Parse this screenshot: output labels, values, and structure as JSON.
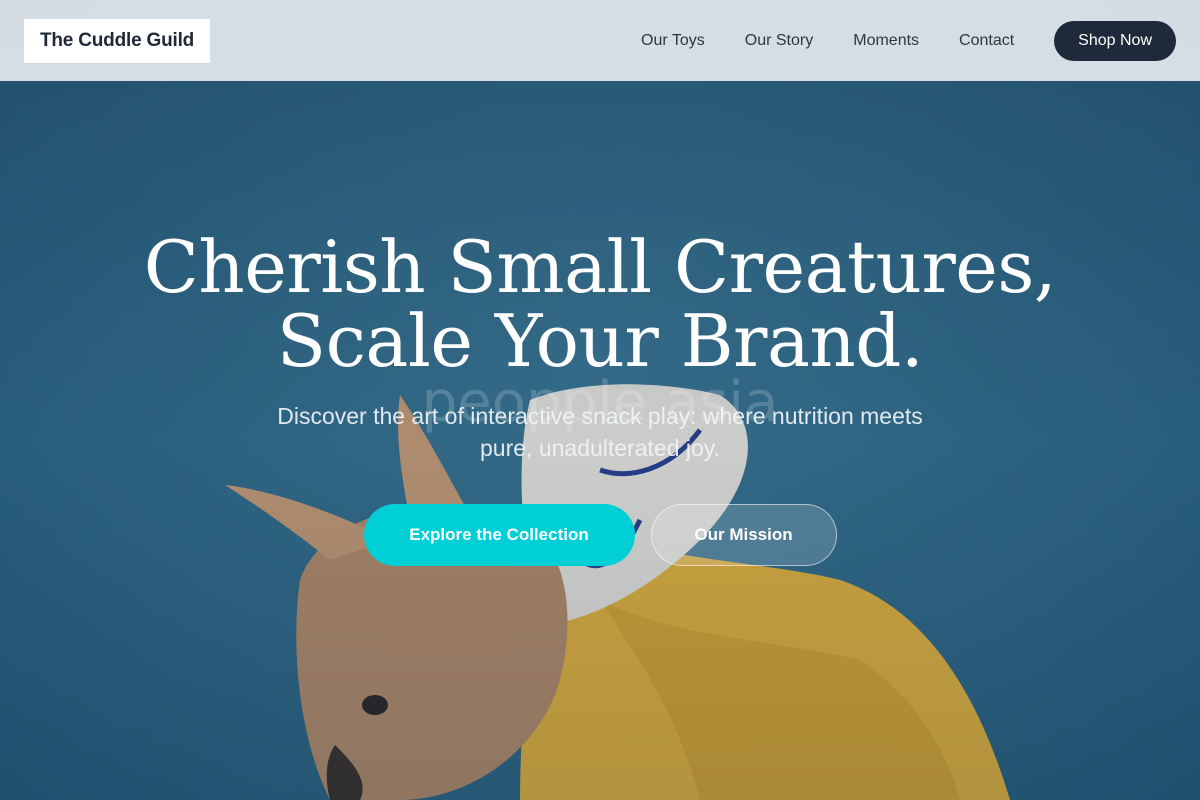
{
  "brand": {
    "name": "The Cuddle Guild"
  },
  "nav": {
    "items": [
      {
        "label": "Our Toys"
      },
      {
        "label": "Our Story"
      },
      {
        "label": "Moments"
      },
      {
        "label": "Contact"
      }
    ],
    "cta_label": "Shop Now"
  },
  "hero": {
    "headline_line1": "Cherish Small Creatures,",
    "headline_line2": "Scale Your Brand.",
    "watermark": "peopple asia",
    "subtitle": "Discover the art of interactive snack play: where nutrition meets pure, unadulterated joy.",
    "primary_cta": "Explore the Collection",
    "secondary_cta": "Our Mission"
  },
  "colors": {
    "nav_bg": "#e2e8ed",
    "shop_button": "#1e293b",
    "primary_cta": "#00cfd6",
    "hero_bg": "#2f6684"
  }
}
